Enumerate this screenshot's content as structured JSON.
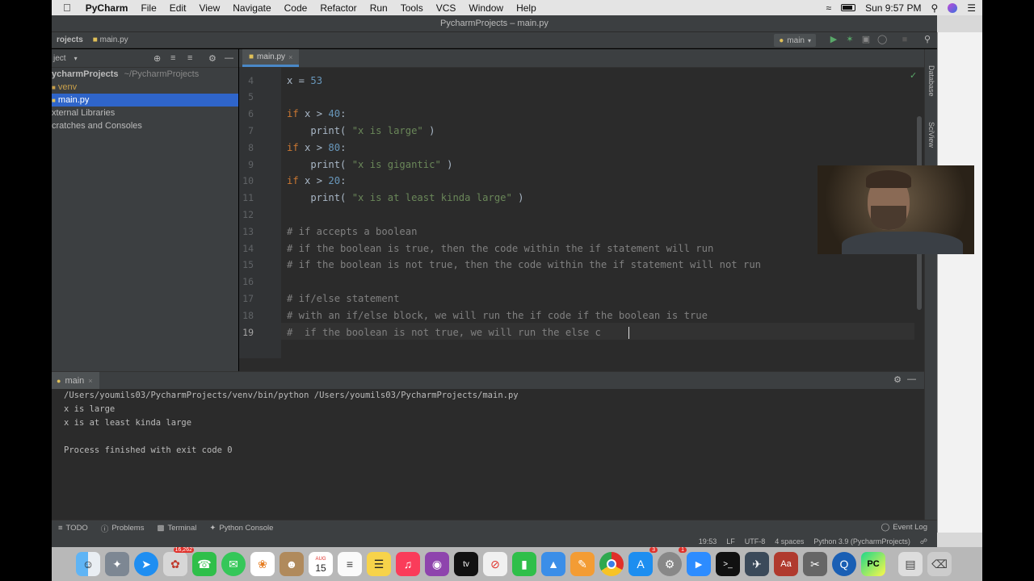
{
  "menubar": {
    "apple": "",
    "app_name": "PyCharm",
    "items": [
      "File",
      "Edit",
      "View",
      "Navigate",
      "Code",
      "Refactor",
      "Run",
      "Tools",
      "VCS",
      "Window",
      "Help"
    ],
    "clock": "Sun 9:57 PM"
  },
  "window": {
    "title": "PycharmProjects – main.py"
  },
  "navbar": {
    "project_crumb": "rojects",
    "file_crumb": "main.py",
    "run_config": "main"
  },
  "project_panel": {
    "header": "ject",
    "items": [
      {
        "label": "ycharmProjects",
        "path": "~/PycharmProjects"
      },
      {
        "label": "venv"
      },
      {
        "label": "main.py"
      },
      {
        "label": "xternal Libraries"
      },
      {
        "label": "cratches and Consoles"
      }
    ]
  },
  "editor": {
    "tab_label": "main.py",
    "current_line": "19",
    "lines": [
      {
        "n": "4",
        "text": "x = 53"
      },
      {
        "n": "5",
        "text": ""
      },
      {
        "n": "6",
        "text": "if x > 40:"
      },
      {
        "n": "7",
        "text": "    print( \"x is large\" )"
      },
      {
        "n": "8",
        "text": "if x > 80:"
      },
      {
        "n": "9",
        "text": "    print( \"x is gigantic\" )"
      },
      {
        "n": "10",
        "text": "if x > 20:"
      },
      {
        "n": "11",
        "text": "    print( \"x is at least kinda large\" )"
      },
      {
        "n": "12",
        "text": ""
      },
      {
        "n": "13",
        "text": "# if accepts a boolean"
      },
      {
        "n": "14",
        "text": "# if the boolean is true, then the code within the if statement will run"
      },
      {
        "n": "15",
        "text": "# if the boolean is not true, then the code within the if statement will not run"
      },
      {
        "n": "16",
        "text": ""
      },
      {
        "n": "17",
        "text": "# if/else statement"
      },
      {
        "n": "18",
        "text": "# with an if/else block, we will run the if code if the boolean is true"
      },
      {
        "n": "19",
        "text": "#  if the boolean is not true, we will run the else c"
      }
    ]
  },
  "right_strip": {
    "database": "Database",
    "sciview": "SciView"
  },
  "run_panel": {
    "tab_label": "main",
    "output": [
      "/Users/youmils03/PycharmProjects/venv/bin/python /Users/youmils03/PycharmProjects/main.py",
      "x is large",
      "x is at least kinda large",
      "",
      "Process finished with exit code 0"
    ]
  },
  "toolwindows": {
    "todo": "TODO",
    "problems": "Problems",
    "terminal": "Terminal",
    "python_console": "Python Console",
    "event_log": "Event Log"
  },
  "statusbar": {
    "position": "19:53",
    "line_sep": "LF",
    "encoding": "UTF-8",
    "indent": "4 spaces",
    "interpreter": "Python 3.9 (PycharmProjects)"
  },
  "dock": {
    "calendar_day": "15",
    "calendar_month": "AUG",
    "photos_badge": "16,262",
    "appstore_badge": "3",
    "settings_badge": "1"
  },
  "colors": {
    "keyword": "#cc7832",
    "number": "#6897bb",
    "string": "#6a8759",
    "comment": "#808080",
    "ide_bg": "#2b2b2b",
    "panel_bg": "#3c3f41"
  }
}
